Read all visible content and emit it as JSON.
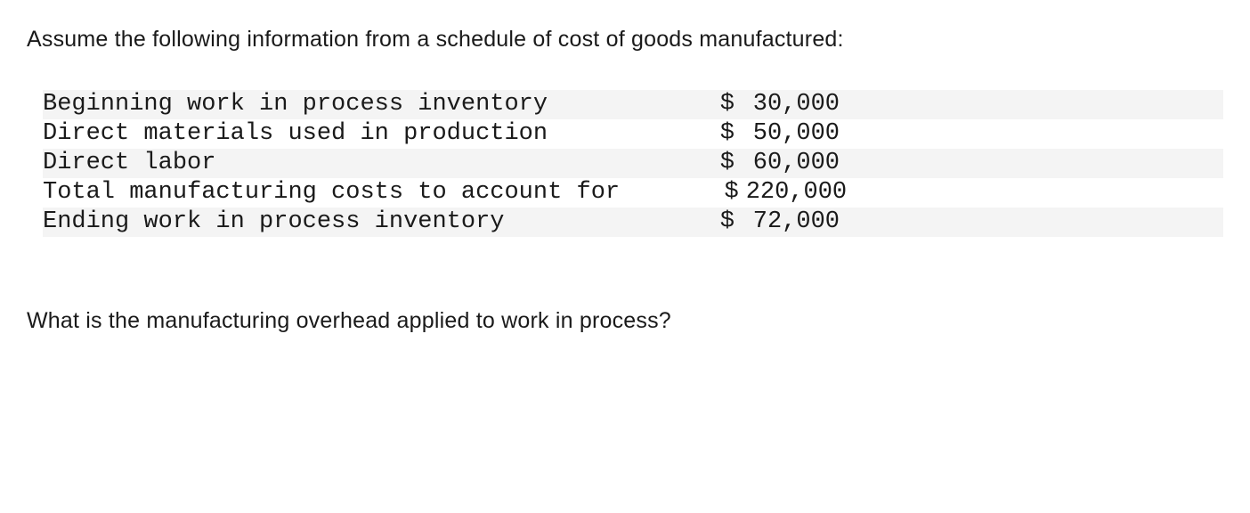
{
  "intro": "Assume the following information from a schedule of cost of goods manufactured:",
  "rows": [
    {
      "label": "Beginning work in process inventory",
      "currency": "$",
      "amount": "30,000"
    },
    {
      "label": "Direct materials used in production",
      "currency": "$",
      "amount": "50,000"
    },
    {
      "label": "Direct labor",
      "currency": "$",
      "amount": "60,000"
    },
    {
      "label": "Total manufacturing costs to account for",
      "currency": "$",
      "amount": "220,000"
    },
    {
      "label": "Ending work in process inventory",
      "currency": "$",
      "amount": "72,000"
    }
  ],
  "question": "What is the manufacturing overhead applied to work in process?"
}
